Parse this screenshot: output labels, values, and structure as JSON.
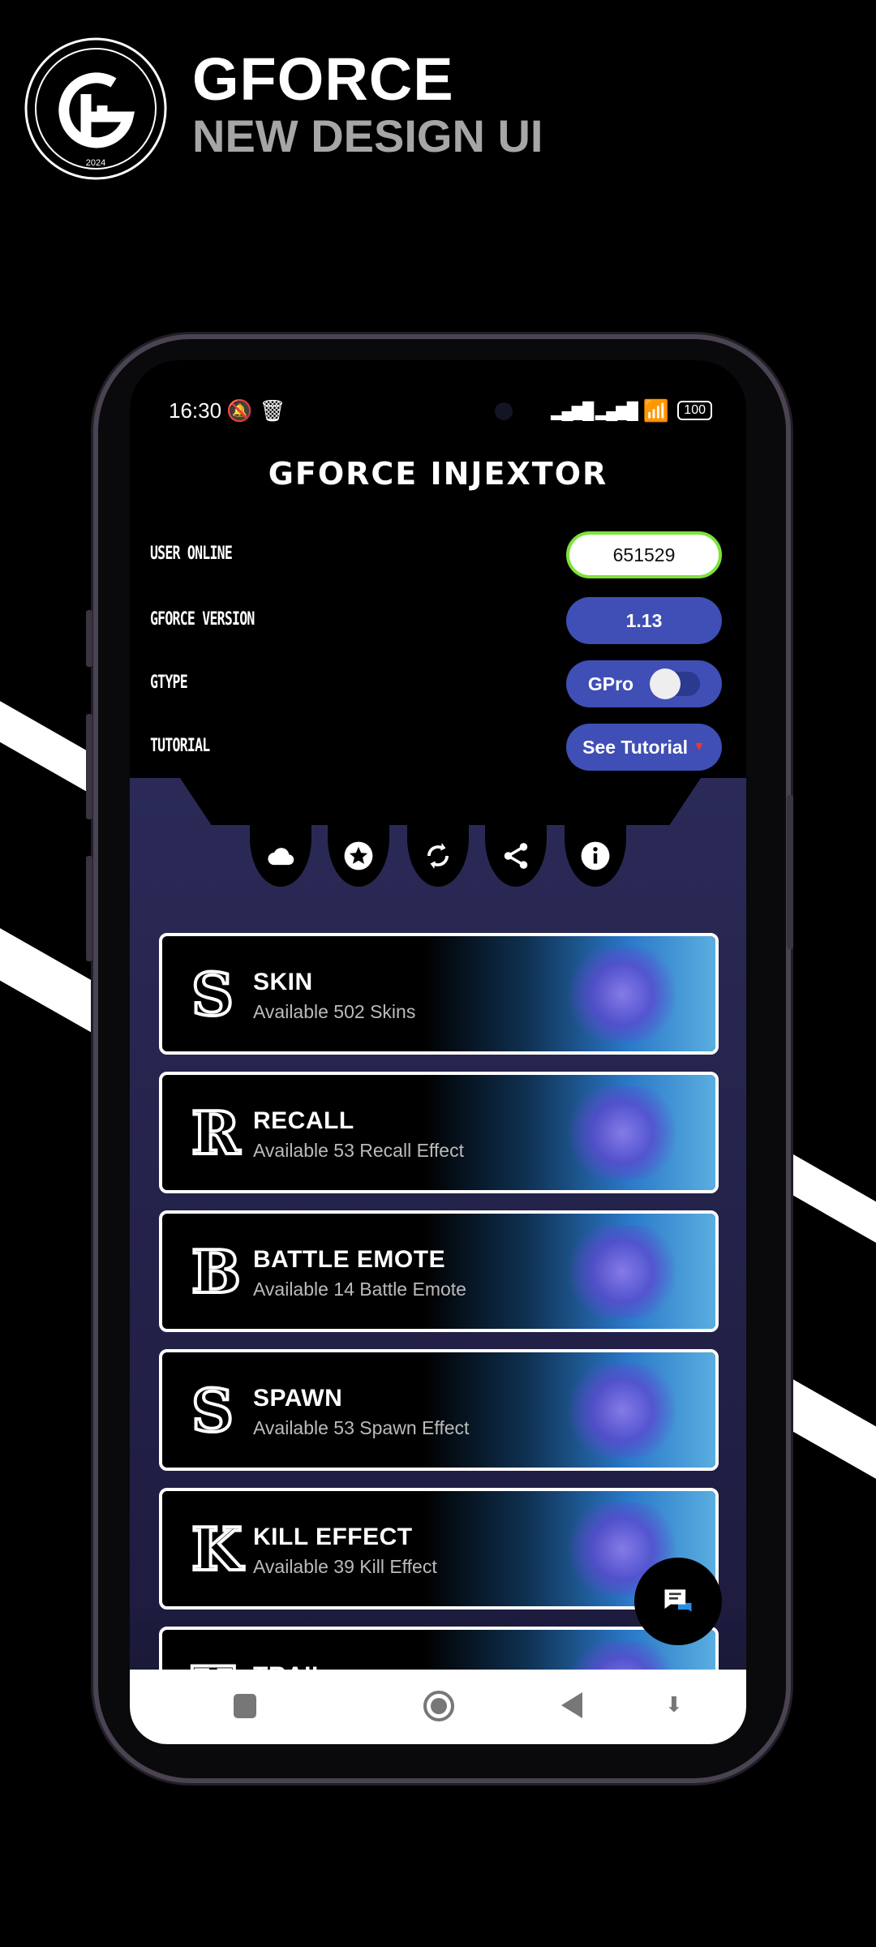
{
  "brand": {
    "title": "GFORCE",
    "subtitle": "NEW DESIGN UI",
    "logo_text": "2024 GForce Injector"
  },
  "status_bar": {
    "time": "16:30",
    "battery": "100"
  },
  "app": {
    "title": "GFORCE INJEXTOR"
  },
  "info_rows": [
    {
      "label": "USER ONLINE",
      "value": "651529"
    },
    {
      "label": "GFORCE VERSION",
      "value": "1.13"
    },
    {
      "label": "GTYPE",
      "value": "GPro",
      "toggle_on": false
    },
    {
      "label": "TUTORIAL",
      "value": "See Tutorial"
    }
  ],
  "toolbar_icons": [
    "cloud-icon",
    "star-badge-icon",
    "refresh-icon",
    "share-icon",
    "info-icon"
  ],
  "cards": [
    {
      "letter": "S",
      "title": "SKIN",
      "subtitle": "Available 502 Skins"
    },
    {
      "letter": "R",
      "title": "RECALL",
      "subtitle": "Available 53 Recall Effect"
    },
    {
      "letter": "B",
      "title": "BATTLE EMOTE",
      "subtitle": "Available 14 Battle Emote"
    },
    {
      "letter": "S",
      "title": "SPAWN",
      "subtitle": "Available 53 Spawn Effect"
    },
    {
      "letter": "K",
      "title": "KILL EFFECT",
      "subtitle": "Available 39 Kill Effect"
    },
    {
      "letter": "T",
      "title": "TRAIL",
      "subtitle": ""
    }
  ],
  "colors": {
    "accent": "#3f4fb5",
    "online_border": "#7de23a",
    "content_bg": "#2b2a57"
  }
}
